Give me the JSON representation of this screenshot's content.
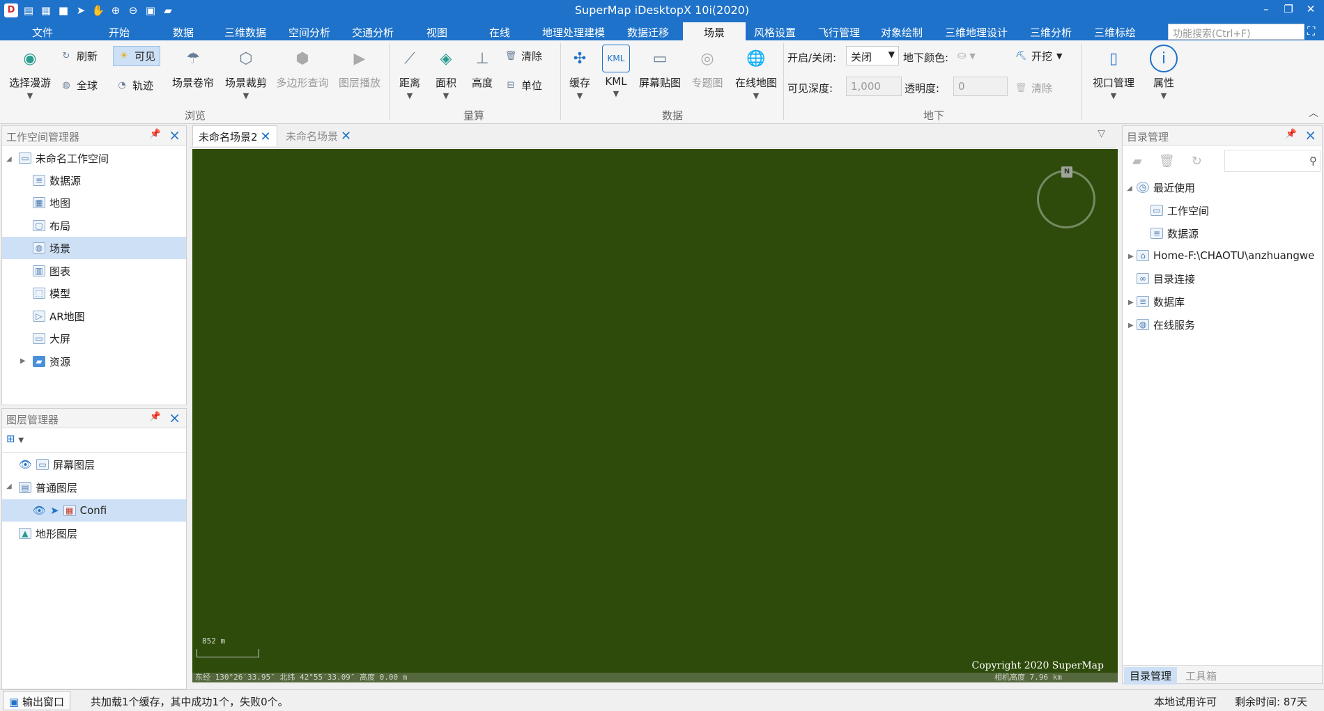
{
  "app": {
    "title": "SuperMap iDesktopX 10i(2020)"
  },
  "menu": {
    "items": [
      "文件",
      "开始",
      "数据",
      "三维数据",
      "空间分析",
      "交通分析",
      "视图",
      "在线",
      "地理处理建模",
      "数据迁移",
      "场景",
      "风格设置",
      "飞行管理",
      "对象绘制",
      "三维地理设计",
      "三维分析",
      "三维标绘"
    ],
    "active": "场景",
    "search_placeholder": "功能搜索(Ctrl+F)"
  },
  "ribbon": {
    "browse": {
      "group": "浏览",
      "roam": "选择漫游",
      "refresh": "刷新",
      "visible": "可见",
      "globe": "全球",
      "track": "轨迹",
      "curtain": "场景卷帘",
      "clip": "场景裁剪",
      "poly_query": "多边形查询",
      "layer_play": "图层播放"
    },
    "measure": {
      "group": "量算",
      "distance": "距离",
      "area": "面积",
      "height": "高度",
      "clear": "清除",
      "unit": "单位"
    },
    "data": {
      "group": "数据",
      "cache": "缓存",
      "kml": "KML",
      "kml_icon": "KML",
      "screen": "屏幕贴图",
      "theme": "专题图",
      "online": "在线地图"
    },
    "underground": {
      "group": "地下",
      "toggle_label": "开启/关闭:",
      "toggle_value": "关闭",
      "color_label": "地下颜色:",
      "dig": "开挖",
      "depth_label": "可见深度:",
      "depth_value": "1,000",
      "alpha_label": "透明度:",
      "alpha_value": "0",
      "clear": "清除"
    },
    "view": {
      "viewport": "视口管理",
      "props": "属性"
    }
  },
  "workspace": {
    "title": "工作空间管理器",
    "root": "未命名工作空间",
    "items": [
      "数据源",
      "地图",
      "布局",
      "场景",
      "图表",
      "模型",
      "AR地图",
      "大屏",
      "资源"
    ]
  },
  "layers": {
    "title": "图层管理器",
    "screen": "屏幕图层",
    "normal": "普通图层",
    "confi": "Confi",
    "terrain": "地形图层"
  },
  "tabs": {
    "tab1": "未命名场景2",
    "tab2": "未命名场景"
  },
  "scene": {
    "scale": "852 m",
    "copyright": "Copyright 2020 SuperMap",
    "coords": "东经 130°26′33.95″  北纬 42°55′33.09″  高度 0.00 m",
    "camera": "相机高度 7.96 km",
    "compass_n": "N"
  },
  "catalog": {
    "title": "目录管理",
    "recent": "最近使用",
    "workspace": "工作空间",
    "datasource": "数据源",
    "home": "Home-F:\\CHAOTU\\anzhuangwe",
    "connect": "目录连接",
    "database": "数据库",
    "online": "在线服务",
    "tab_catalog": "目录管理",
    "tab_toolbox": "工具箱"
  },
  "status": {
    "output": "输出窗口",
    "message": "共加载1个缓存，其中成功1个，失败0个。",
    "license": "本地试用许可",
    "remaining": "剩余时间: 87天"
  },
  "colors": {
    "accent": "#1e72c9",
    "scene_bg": "#2e4b0b",
    "selection": "#cde0f5"
  }
}
